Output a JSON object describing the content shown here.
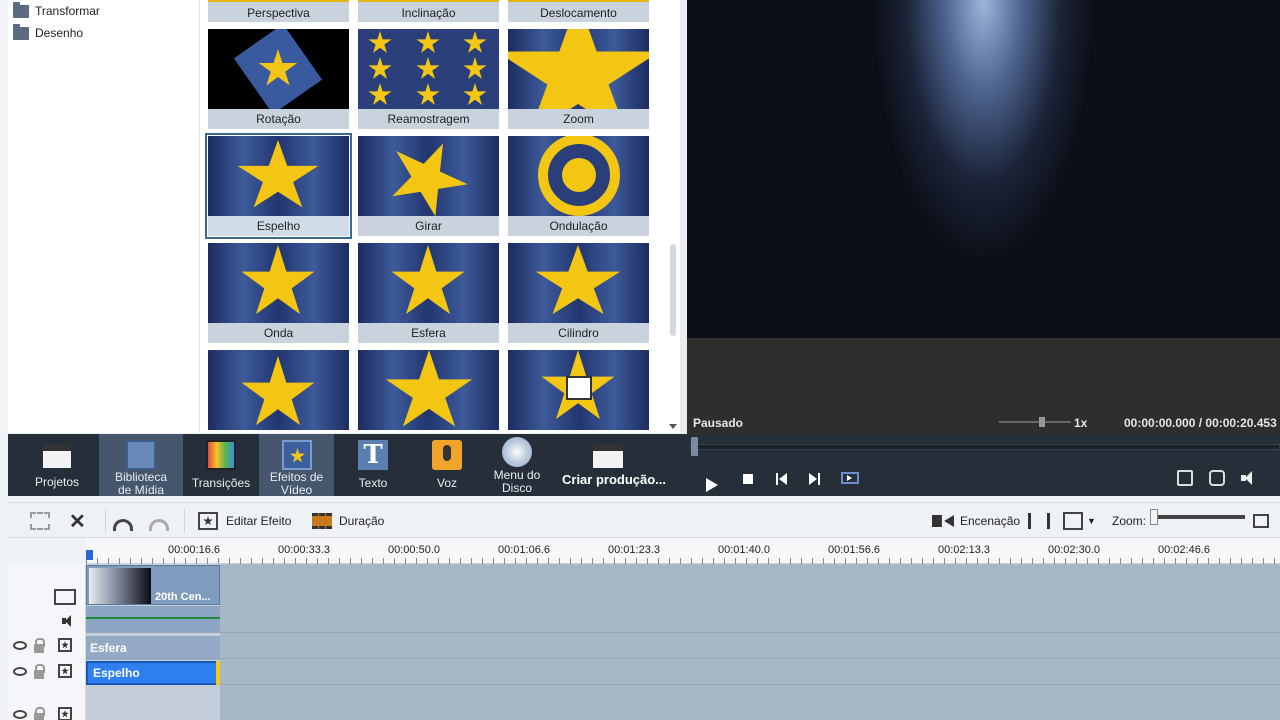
{
  "tree": {
    "items": [
      {
        "label": "Transformar",
        "icon": "folder-icon"
      },
      {
        "label": "Desenho",
        "icon": "folder-icon"
      }
    ]
  },
  "effects": {
    "top_captions": [
      "Perspectiva",
      "Inclinação",
      "Deslocamento"
    ],
    "tiles": [
      {
        "label": "Rotação",
        "selected": false
      },
      {
        "label": "Reamostragem",
        "selected": false
      },
      {
        "label": "Zoom",
        "selected": false
      },
      {
        "label": "Espelho",
        "selected": true
      },
      {
        "label": "Girar",
        "selected": false
      },
      {
        "label": "Ondulação",
        "selected": false
      },
      {
        "label": "Onda",
        "selected": false
      },
      {
        "label": "Esfera",
        "selected": false
      },
      {
        "label": "Cilindro",
        "selected": false
      }
    ]
  },
  "preview": {
    "status": "Pausado",
    "speed": "1x",
    "time": "00:00:00.000 / 00:00:20.453"
  },
  "main_toolbar": {
    "projects": "Projetos",
    "media_library": "Biblioteca de Mídia",
    "transitions": "Transições",
    "video_effects": "Efeitos de Vídeo",
    "text": "Texto",
    "voice": "Voz",
    "disc_menu": "Menu do Disco",
    "export": "Criar produção..."
  },
  "edit_toolbar": {
    "edit_effect": "Editar Efeito",
    "duration": "Duração",
    "staging": "Encenação",
    "zoom": "Zoom:"
  },
  "timeline": {
    "ruler_labels": [
      "00:00:16.6",
      "00:00:33.3",
      "00:00:50.0",
      "00:01:06.6",
      "00:01:23.3",
      "00:01:40.0",
      "00:01:56.6",
      "00:02:13.3",
      "00:02:30.0",
      "00:02:46.6"
    ],
    "video_clip_name": "20th Cen...",
    "effect_tracks": [
      "Esfera",
      "Espelho"
    ]
  },
  "colors": {
    "toolbar_bg": "#262e3a",
    "selected_effect_track": "#2f7ff0",
    "star_yellow": "#f3c613"
  }
}
